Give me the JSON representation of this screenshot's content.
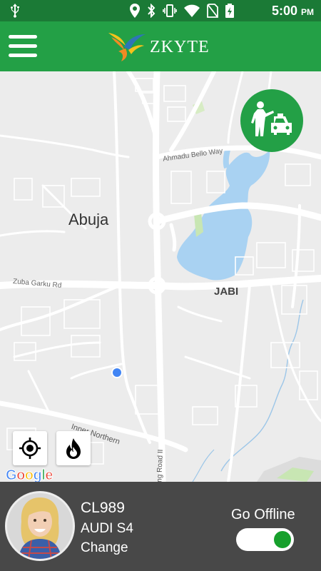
{
  "status_bar": {
    "time": "5:00",
    "ampm": "PM",
    "icons": [
      "usb-icon",
      "location-icon",
      "bluetooth-icon",
      "vibrate-icon",
      "wifi-icon",
      "no-sim-icon",
      "battery-charging-icon"
    ]
  },
  "app_bar": {
    "brand": "ZKYTE",
    "menu_icon": "hamburger-icon"
  },
  "map": {
    "labels": {
      "abuja": "Abuja",
      "jabi": "JABI",
      "ahmadu_bello_way": "Ahmadu Bello Way",
      "zuba_gurku_rd": "Zuba Garku Rd",
      "inner_northern": "Inner Northern",
      "ring_road": "Ring Road II"
    },
    "google_logo": [
      "G",
      "o",
      "o",
      "g",
      "l",
      "e"
    ],
    "colors": {
      "water": "#a9d2f2",
      "park": "#c8e6b3",
      "road": "#ffffff",
      "land": "#ececec",
      "current_location": "#4285f4"
    }
  },
  "taxi_button": {
    "icon": "hail-taxi-icon"
  },
  "locate_button": {
    "icon": "crosshair-icon"
  },
  "hotspot_button": {
    "icon": "flame-icon"
  },
  "driver_panel": {
    "car_code": "CL989",
    "car_model": "AUDI S4",
    "change_label": "Change",
    "status_label": "Go Offline",
    "toggle_on": true
  },
  "theme": {
    "status_bar": "#1b7a36",
    "app_bar": "#23a046",
    "panel": "#484848",
    "toggle_knob": "#17a02c"
  }
}
